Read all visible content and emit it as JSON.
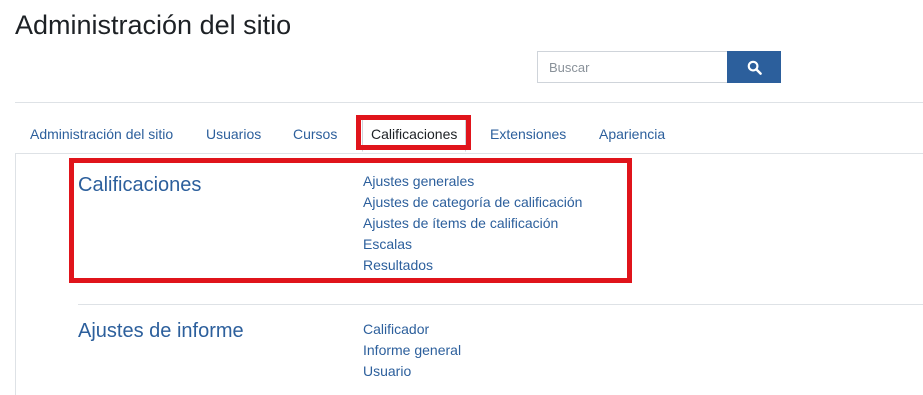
{
  "page": {
    "title": "Administración del sitio"
  },
  "search": {
    "placeholder": "Buscar",
    "icon": "search-icon"
  },
  "colors": {
    "link": "#2c5f9c",
    "button": "#2c5f9c",
    "highlight": "#e0141b"
  },
  "tabs": [
    {
      "label": "Administración del sitio"
    },
    {
      "label": "Usuarios"
    },
    {
      "label": "Cursos"
    },
    {
      "label": "Calificaciones",
      "active": true
    },
    {
      "label": "Extensiones"
    },
    {
      "label": "Apariencia"
    }
  ],
  "sections": [
    {
      "title": "Calificaciones",
      "links": [
        "Ajustes generales",
        "Ajustes de categoría de calificación",
        "Ajustes de ítems de calificación",
        "Escalas",
        "Resultados"
      ]
    },
    {
      "title": "Ajustes de informe",
      "links": [
        "Calificador",
        "Informe general",
        "Usuario"
      ]
    }
  ]
}
